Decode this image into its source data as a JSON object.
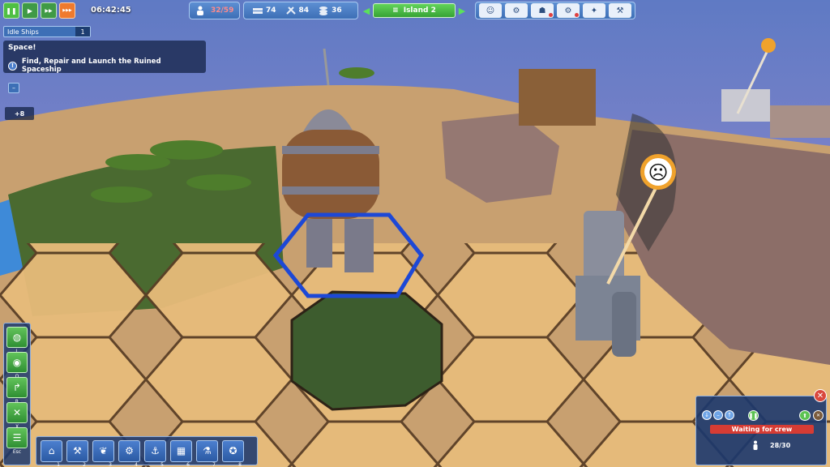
{
  "game": {
    "clock": "06:42:45",
    "speed_controls": [
      {
        "icon": "pause-icon",
        "glyph": "❚❚"
      },
      {
        "icon": "play-speed-1-icon",
        "glyph": "▶"
      },
      {
        "icon": "play-speed-2-icon",
        "glyph": "▶▶"
      },
      {
        "icon": "play-speed-3-icon",
        "glyph": "▶▶▶"
      }
    ]
  },
  "resources": {
    "population": "32/59",
    "tools": "74",
    "hammers": "84",
    "materials": "36"
  },
  "island": {
    "name": "Island 2",
    "prev_glyph": "◀",
    "next_glyph": "▶",
    "list_glyph": "≡"
  },
  "menu_buttons": [
    {
      "icon": "happiness-icon",
      "glyph": "☺"
    },
    {
      "icon": "logistics-icon",
      "glyph": "⚙"
    },
    {
      "icon": "workers-icon",
      "glyph": "☗"
    },
    {
      "icon": "settings-icon",
      "glyph": "⚙"
    },
    {
      "icon": "research-icon",
      "glyph": "✦"
    },
    {
      "icon": "tools-icon",
      "glyph": "⚒"
    }
  ],
  "idle_ships": {
    "label": "Idle Ships",
    "count": "1"
  },
  "quest": {
    "title": "Space!",
    "badge": "!",
    "task": "Find, Repair and Launch the Ruined Spaceship"
  },
  "notification": {
    "label": "+8"
  },
  "collapse_glyph": "–",
  "side_tools": [
    {
      "icon": "globe-icon",
      "glyph": "◍",
      "key": "L"
    },
    {
      "icon": "overview-icon",
      "glyph": "◉",
      "key": "O"
    },
    {
      "icon": "road-icon",
      "glyph": "↱",
      "key": "R"
    },
    {
      "icon": "demolish-icon",
      "glyph": "✕",
      "key": "X"
    },
    {
      "icon": "menu-icon",
      "glyph": "☰",
      "key": "Esc"
    }
  ],
  "build_bar": [
    {
      "icon": "housing-icon",
      "glyph": "⌂",
      "key": "1"
    },
    {
      "icon": "production-icon",
      "glyph": "⚒",
      "key": "2"
    },
    {
      "icon": "farming-icon",
      "glyph": "❦",
      "key": "3"
    },
    {
      "icon": "industry-icon",
      "glyph": "⚙",
      "key": "4"
    },
    {
      "icon": "harbor-icon",
      "glyph": "⚓",
      "key": "5"
    },
    {
      "icon": "storage-icon",
      "glyph": "▦",
      "key": "6"
    },
    {
      "icon": "science-icon",
      "glyph": "⚗",
      "key": "7"
    },
    {
      "icon": "special-icon",
      "glyph": "✪",
      "key": "8"
    }
  ],
  "building_panel": {
    "close_glyph": "✕",
    "status": "Waiting for crew",
    "crew": "28/30",
    "priority_glyphs": [
      "↓",
      "–",
      "↑"
    ],
    "pause_glyph": "❚❚",
    "upgrade_glyph": "⬆",
    "demolish_glyph": "✕"
  },
  "world": {
    "unhappy_glyph": "☹",
    "sky_color": "#6f86c8",
    "sand_color": "#e5b978",
    "grass_color": "#3d5c2e",
    "rock_color": "#8c6e68"
  }
}
